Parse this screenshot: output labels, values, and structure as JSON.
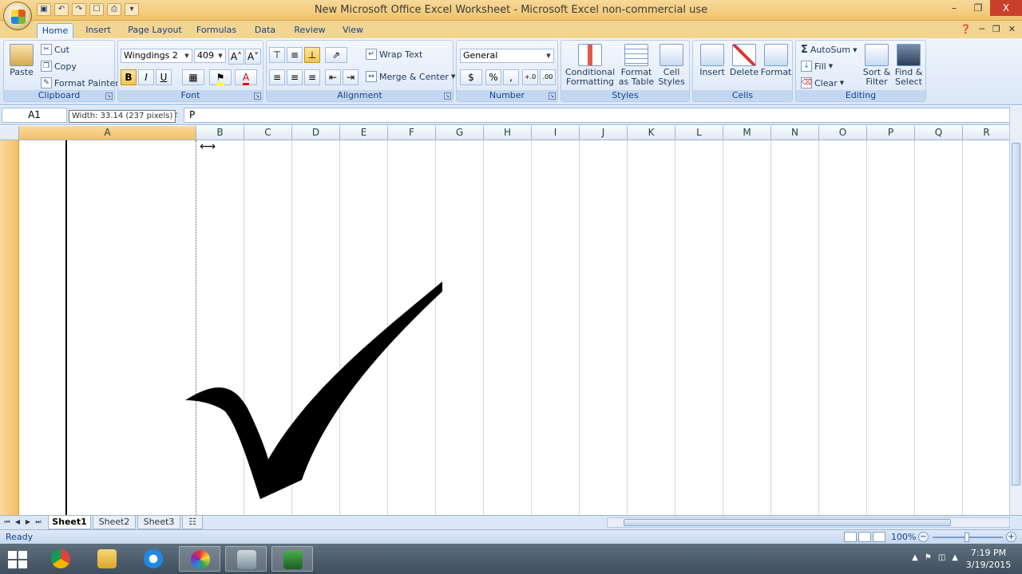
{
  "window": {
    "title": "New Microsoft Office Excel Worksheet - Microsoft Excel non-commercial use",
    "controls": [
      "–",
      "❐",
      "X"
    ]
  },
  "tabs": [
    "Home",
    "Insert",
    "Page Layout",
    "Formulas",
    "Data",
    "Review",
    "View"
  ],
  "ribbon": {
    "clipboard": {
      "label": "Clipboard",
      "paste": "Paste",
      "cut": "Cut",
      "copy": "Copy",
      "format_painter": "Format Painter"
    },
    "font": {
      "label": "Font",
      "font_name": "Wingdings 2",
      "font_size": "409",
      "bold": "B",
      "italic": "I",
      "underline": "U",
      "grow": "A˄",
      "shrink": "A˅",
      "font_color": "A"
    },
    "alignment": {
      "label": "Alignment",
      "wrap_text": "Wrap Text",
      "merge_center": "Merge & Center"
    },
    "number": {
      "label": "Number",
      "format": "General",
      "currency": "$",
      "percent": "%",
      "comma": ",",
      "inc_dec": "+.0",
      "dec_dec": ".00"
    },
    "styles": {
      "label": "Styles",
      "conditional": "Conditional Formatting",
      "conditional_1": "Conditional",
      "conditional_2": "Formatting",
      "table_1": "Format",
      "table_2": "as Table",
      "cell_1": "Cell",
      "cell_2": "Styles"
    },
    "cells": {
      "label": "Cells",
      "insert": "Insert",
      "delete": "Delete",
      "format": "Format"
    },
    "editing": {
      "label": "Editing",
      "autosum": "AutoSum",
      "fill": "Fill",
      "clear": "Clear",
      "sort_1": "Sort &",
      "sort_2": "Filter",
      "find_1": "Find &",
      "find_2": "Select"
    }
  },
  "formula_bar": {
    "name_box": "A1",
    "tooltip": "Width: 33.14 (237 pixels)",
    "fx": "fx",
    "formula": "P"
  },
  "columns": [
    "A",
    "B",
    "C",
    "D",
    "E",
    "F",
    "G",
    "H",
    "I",
    "J",
    "K",
    "L",
    "M",
    "N",
    "O",
    "P",
    "Q",
    "R"
  ],
  "sheets": [
    "Sheet1",
    "Sheet2",
    "Sheet3"
  ],
  "status": {
    "ready": "Ready",
    "zoom": "100%",
    "zoom_minus": "−",
    "zoom_plus": "+"
  },
  "taskbar": {
    "time": "7:19 PM",
    "date": "3/19/2015"
  },
  "colors": {
    "title_bar": "#f1c46b",
    "ribbon": "#dbe7f6",
    "selected_header": "#f1c15f",
    "checkmark": "#000000"
  }
}
